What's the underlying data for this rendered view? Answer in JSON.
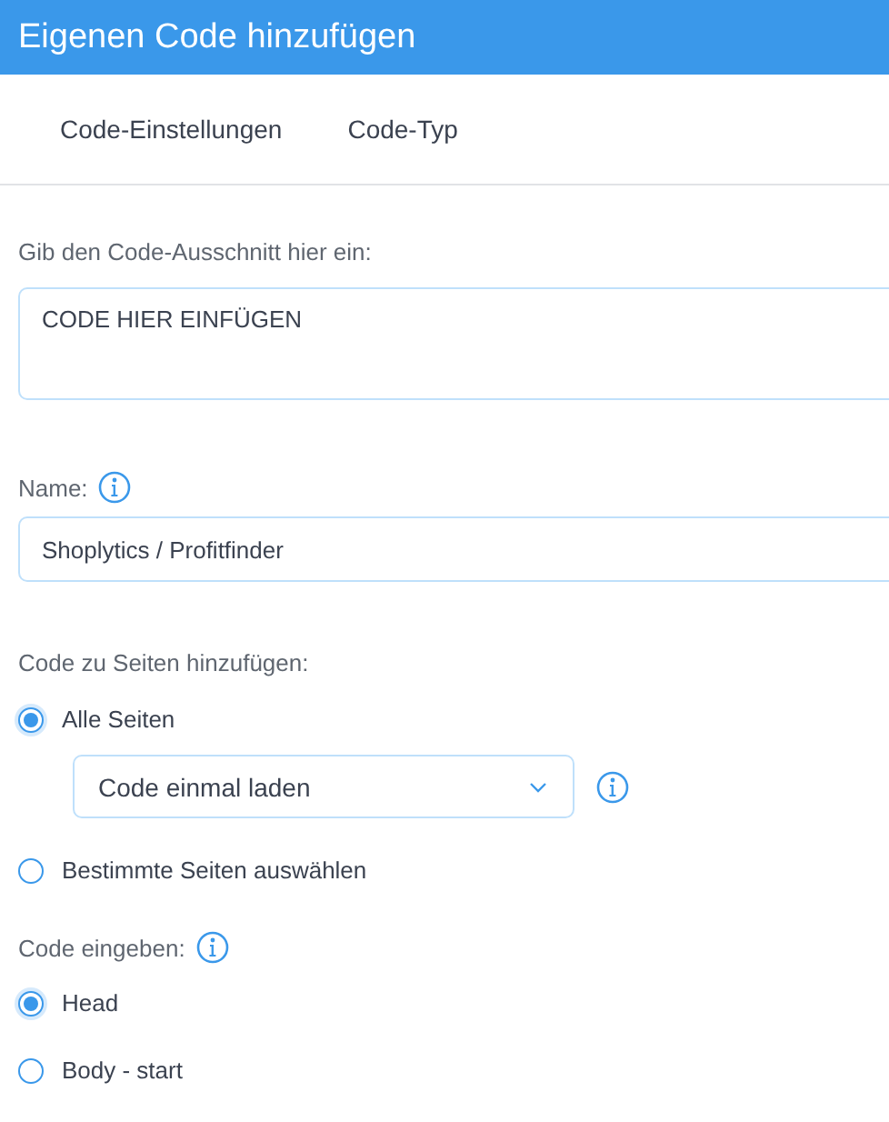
{
  "window": {
    "title": "Eigenen Code hinzufügen"
  },
  "tabs": [
    {
      "label": "Code-Einstellungen"
    },
    {
      "label": "Code-Typ"
    }
  ],
  "snippet": {
    "label": "Gib den Code-Ausschnitt hier ein:",
    "value": "CODE HIER EINFÜGEN"
  },
  "name": {
    "label": "Name:",
    "value": "Shoplytics / Profitfinder"
  },
  "pages": {
    "label": "Code zu Seiten hinzufügen:",
    "options": [
      {
        "label": "Alle Seiten",
        "selected": true,
        "dropdown": {
          "value": "Code einmal laden"
        }
      },
      {
        "label": "Bestimmte Seiten auswählen",
        "selected": false
      }
    ]
  },
  "placement": {
    "label": "Code eingeben:",
    "options": [
      {
        "label": "Head",
        "selected": true
      },
      {
        "label": "Body - start",
        "selected": false
      }
    ]
  }
}
